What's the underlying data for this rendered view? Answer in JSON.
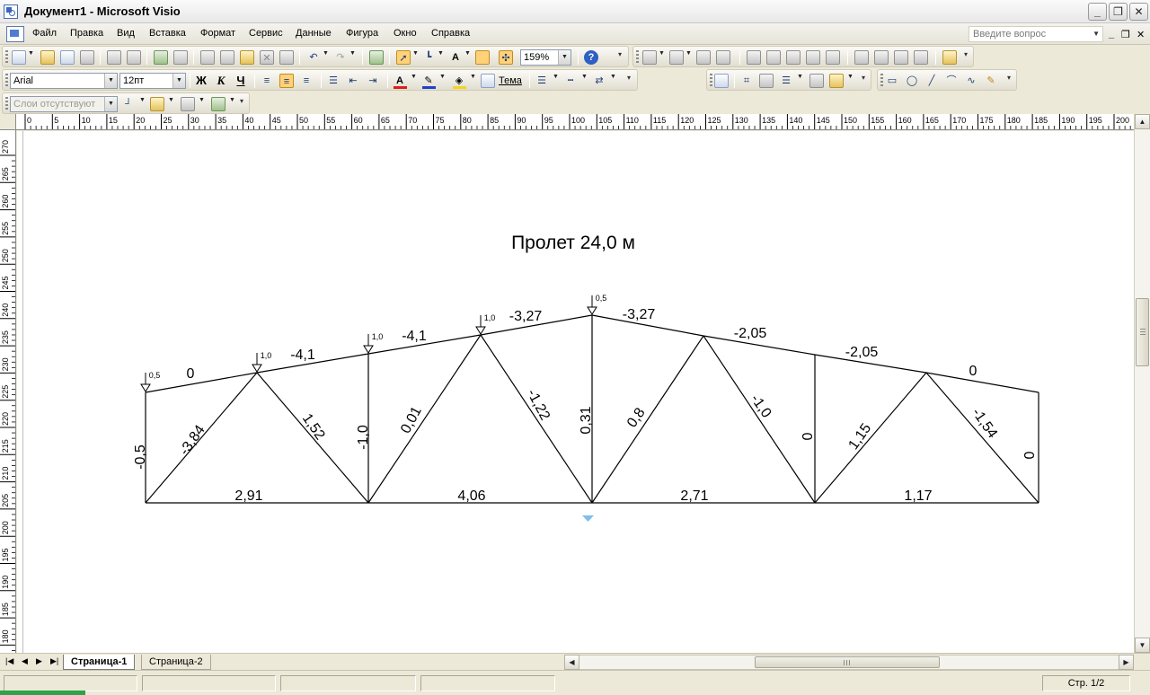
{
  "window": {
    "title": "Документ1 - Microsoft Visio",
    "minimize": "_",
    "restore": "❐",
    "close": "✕"
  },
  "menu": {
    "items": [
      "Файл",
      "Правка",
      "Вид",
      "Вставка",
      "Формат",
      "Сервис",
      "Данные",
      "Фигура",
      "Окно",
      "Справка"
    ],
    "help_placeholder": "Введите вопрос",
    "mdi_minimize": "_",
    "mdi_restore": "❐",
    "mdi_close": "✕"
  },
  "toolbar": {
    "zoom": "159%",
    "font": "Arial",
    "font_size": "12пт",
    "bold": "Ж",
    "italic": "К",
    "underline": "Ч",
    "theme_label": "Тема",
    "layers": "Слои отсутствуют",
    "font_color": "#e01b1b",
    "line_color": "#1f3fd0",
    "fill_color": "#f4d41a"
  },
  "rulers": {
    "horizontal": [
      "0",
      "5",
      "10",
      "15",
      "20",
      "25",
      "30",
      "35",
      "40",
      "45",
      "50",
      "55",
      "60",
      "65",
      "70",
      "75",
      "80",
      "85",
      "90",
      "95",
      "100",
      "105",
      "110",
      "115",
      "120",
      "125",
      "130",
      "135",
      "140",
      "145",
      "150",
      "155",
      "160",
      "165",
      "170",
      "175",
      "180",
      "185",
      "190",
      "195",
      "200"
    ],
    "vertical": [
      "270",
      "265",
      "260",
      "255",
      "250",
      "245",
      "240",
      "235",
      "230",
      "225",
      "220",
      "215",
      "210",
      "205",
      "200",
      "195",
      "190",
      "185",
      "180"
    ]
  },
  "drawing": {
    "title": "Пролет 24,0 м",
    "top_chord_forces": [
      "0",
      "-4,1",
      "-4,1",
      "-3,27",
      "-3,27",
      "-2,05",
      "-2,05",
      "0"
    ],
    "bottom_chord_forces": [
      "2,91",
      "4,06",
      "2,71",
      "1,17"
    ],
    "diagonal_forces": [
      "-3,84",
      "1,52",
      "0,01",
      "-1,22",
      "0,8",
      "-1,0",
      "1,15",
      "-1,54"
    ],
    "vertical_forces": [
      "-0,5",
      "-1,0",
      "0,31",
      "0",
      "0"
    ],
    "loads": [
      "0,5",
      "1,0",
      "1,0",
      "1,0",
      "0,5"
    ]
  },
  "tabs": [
    "Страница-1",
    "Страница-2"
  ],
  "status": {
    "page": "Стр. 1/2"
  }
}
